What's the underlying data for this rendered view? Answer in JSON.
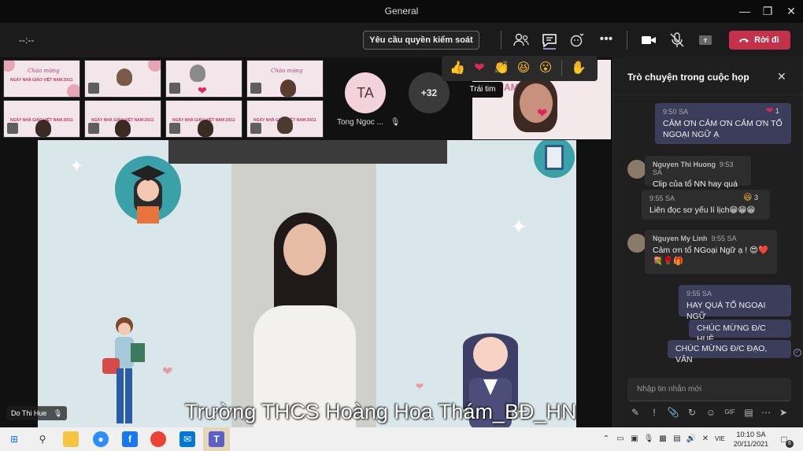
{
  "window": {
    "title": "General"
  },
  "controls": {
    "timer": "--:--",
    "request_control": "Yêu cầu quyền kiểm soát",
    "leave": "Rời đi"
  },
  "stage": {
    "tile_banner_script": "Chào mừng",
    "tile_banner_text": "NGÀY NHÀ GIÁO VIỆT NAM 20/11",
    "ta_initials": "TA",
    "ta_name": "Tong Ngoc ...",
    "more_count": "+32",
    "reaction_tooltip": "Trái tim",
    "reactions": [
      "like",
      "heart",
      "applause",
      "laugh",
      "surprised",
      "raise-hand"
    ],
    "presenter_name": "Do Thi Hue",
    "caption": "Trường THCS Hoàng Hoa Thám_BĐ_HN"
  },
  "chat": {
    "title": "Trò chuyện trong cuộc họp",
    "messages": [
      {
        "time": "9:50 SA",
        "text": "CẢM ƠN CẢM ƠN CẢM ƠN TỔ NGOẠI NGỮ Ạ",
        "reaction_count": "1"
      },
      {
        "sender": "Nguyen Thi Huong",
        "time": "9:53 SA",
        "text": "Clip của tổ NN hay quá"
      },
      {
        "time": "9:55 SA",
        "text": "Liên đọc sơ yếu lí lịch😁😁😁",
        "reaction_count": "3"
      },
      {
        "sender": "Nguyen My Linh",
        "time": "9:55 SA",
        "text": "Cảm ơn tổ NGoại Ngữ ạ ! 😍❤️",
        "text2": "💐🌹🎁"
      },
      {
        "time": "9:55 SA",
        "text": "HAY QUÁ TỔ NGOẠI NGỮ"
      },
      {
        "text": "CHÚC MỪNG Đ/C HUỆ"
      },
      {
        "text": "CHÚC MỪNG Đ/C ĐẠO, VÂN"
      }
    ],
    "compose_placeholder": "Nhập tin nhắn mới"
  },
  "taskbar": {
    "lang": "VIE",
    "time": "10:10 SA",
    "date": "20/11/2021",
    "notification_count": "6"
  }
}
